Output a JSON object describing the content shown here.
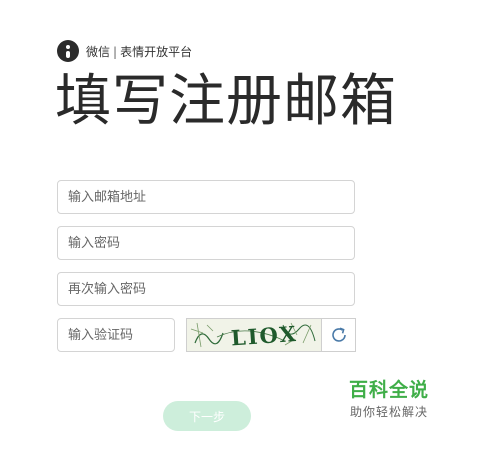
{
  "brand": {
    "logo_icon": "wechat-logo-icon",
    "name": "微信",
    "separator": "|",
    "platform": "表情开放平台"
  },
  "page": {
    "title": "填写注册邮箱"
  },
  "form": {
    "email_placeholder": "输入邮箱地址",
    "password_placeholder": "输入密码",
    "confirm_placeholder": "再次输入密码",
    "captcha_placeholder": "输入验证码",
    "captcha_image_text": "LIOX",
    "refresh_icon": "refresh-icon",
    "next_label": "下一步"
  },
  "watermark": {
    "title": "百科全说",
    "subtitle": "助你轻松解决"
  },
  "colors": {
    "next_button": "#cdeedb",
    "watermark_green": "#3fae48",
    "refresh_blue": "#4a7aa8"
  }
}
